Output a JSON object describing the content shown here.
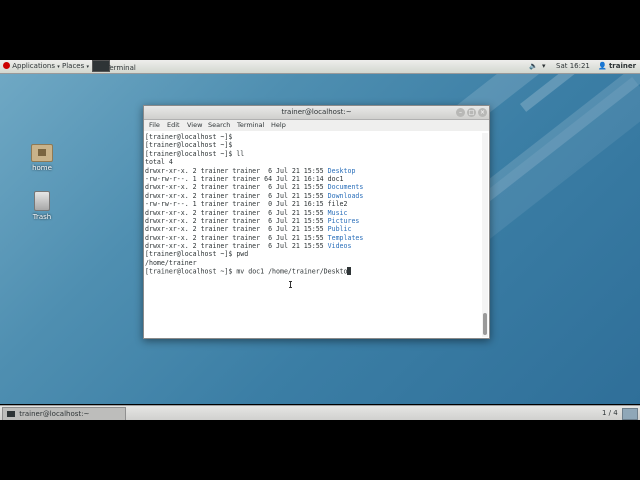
{
  "top_panel": {
    "applications": "Applications",
    "places": "Places",
    "terminal_task": "Terminal",
    "clock": "Sat 16:21",
    "user": "trainer"
  },
  "desktop": {
    "icons": [
      {
        "label": "home",
        "icon": "folder-home-icon"
      },
      {
        "label": "Trash",
        "icon": "trash-icon"
      }
    ]
  },
  "terminal": {
    "title": "trainer@localhost:~",
    "menu": [
      "File",
      "Edit",
      "View",
      "Search",
      "Terminal",
      "Help"
    ],
    "prompt": "[trainer@localhost ~]$",
    "commands": [
      "",
      "",
      "ll",
      "pwd",
      "mv doc1 /home/trainer/Deskto"
    ],
    "total": "total 4",
    "listing": [
      {
        "perm": "drwxr-xr-x.",
        "links": "2",
        "owner": "trainer",
        "group": "trainer",
        "size": " 6",
        "date": "Jul 21 15:55",
        "name": "Desktop",
        "dir": true
      },
      {
        "perm": "-rw-rw-r--.",
        "links": "1",
        "owner": "trainer",
        "group": "trainer",
        "size": "64",
        "date": "Jul 21 16:14",
        "name": "doc1",
        "dir": false
      },
      {
        "perm": "drwxr-xr-x.",
        "links": "2",
        "owner": "trainer",
        "group": "trainer",
        "size": " 6",
        "date": "Jul 21 15:55",
        "name": "Documents",
        "dir": true
      },
      {
        "perm": "drwxr-xr-x.",
        "links": "2",
        "owner": "trainer",
        "group": "trainer",
        "size": " 6",
        "date": "Jul 21 15:55",
        "name": "Downloads",
        "dir": true
      },
      {
        "perm": "-rw-rw-r--.",
        "links": "1",
        "owner": "trainer",
        "group": "trainer",
        "size": " 0",
        "date": "Jul 21 16:15",
        "name": "file2",
        "dir": false
      },
      {
        "perm": "drwxr-xr-x.",
        "links": "2",
        "owner": "trainer",
        "group": "trainer",
        "size": " 6",
        "date": "Jul 21 15:55",
        "name": "Music",
        "dir": true
      },
      {
        "perm": "drwxr-xr-x.",
        "links": "2",
        "owner": "trainer",
        "group": "trainer",
        "size": " 6",
        "date": "Jul 21 15:55",
        "name": "Pictures",
        "dir": true
      },
      {
        "perm": "drwxr-xr-x.",
        "links": "2",
        "owner": "trainer",
        "group": "trainer",
        "size": " 6",
        "date": "Jul 21 15:55",
        "name": "Public",
        "dir": true
      },
      {
        "perm": "drwxr-xr-x.",
        "links": "2",
        "owner": "trainer",
        "group": "trainer",
        "size": " 6",
        "date": "Jul 21 15:55",
        "name": "Templates",
        "dir": true
      },
      {
        "perm": "drwxr-xr-x.",
        "links": "2",
        "owner": "trainer",
        "group": "trainer",
        "size": " 6",
        "date": "Jul 21 15:55",
        "name": "Videos",
        "dir": true
      }
    ],
    "pwd_output": "/home/trainer",
    "dir_color": "#2a6fba"
  },
  "bottom_panel": {
    "task": "trainer@localhost:~",
    "workspace": "1 / 4"
  }
}
